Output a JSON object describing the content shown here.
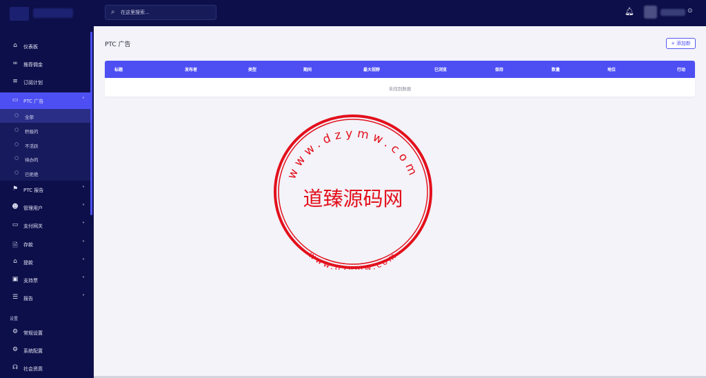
{
  "header": {
    "search_placeholder": "在这里搜索...",
    "search_icon": "search-icon",
    "bell_icon": "bell-icon"
  },
  "sidebar": {
    "items": [
      {
        "label": "仪表板",
        "icon": "home-icon"
      },
      {
        "label": "推荐佣金",
        "icon": "link-icon"
      },
      {
        "label": "订阅计划",
        "icon": "list-icon"
      },
      {
        "label": "PTC 广告",
        "icon": "ad-icon"
      },
      {
        "label": "PTC 报告",
        "icon": "flag-icon"
      },
      {
        "label": "管理用户",
        "icon": "users-icon"
      },
      {
        "label": "支付网关",
        "icon": "card-icon"
      },
      {
        "label": "存款",
        "icon": "deposit-icon"
      },
      {
        "label": "提款",
        "icon": "bank-icon"
      },
      {
        "label": "支持票",
        "icon": "ticket-icon"
      },
      {
        "label": "报告",
        "icon": "report-icon"
      }
    ],
    "sub_items": [
      {
        "label": "全部"
      },
      {
        "label": "积极的"
      },
      {
        "label": "不活跃"
      },
      {
        "label": "待办的"
      },
      {
        "label": "已拒绝"
      }
    ],
    "section_title": "设置",
    "settings_items": [
      {
        "label": "常规设置",
        "icon": "settings-icon"
      },
      {
        "label": "系统配置",
        "icon": "gear-icon"
      },
      {
        "label": "社会资质",
        "icon": "social-icon"
      }
    ]
  },
  "main": {
    "title": "PTC 广告",
    "add_button": "添加新",
    "columns": [
      "标题",
      "发布者",
      "类型",
      "期间",
      "最大视野",
      "已浏览",
      "保持",
      "数量",
      "地位",
      "行动"
    ],
    "empty_text": "未找到数据"
  },
  "watermark": {
    "center_text": "道臻源码网",
    "top_arc": "www.dzymw.com",
    "bottom_arc": "www.dzymw.com"
  },
  "colors": {
    "navy": "#0d0f4a",
    "accent": "#4d4ff3",
    "stamp": "#e3101c"
  }
}
